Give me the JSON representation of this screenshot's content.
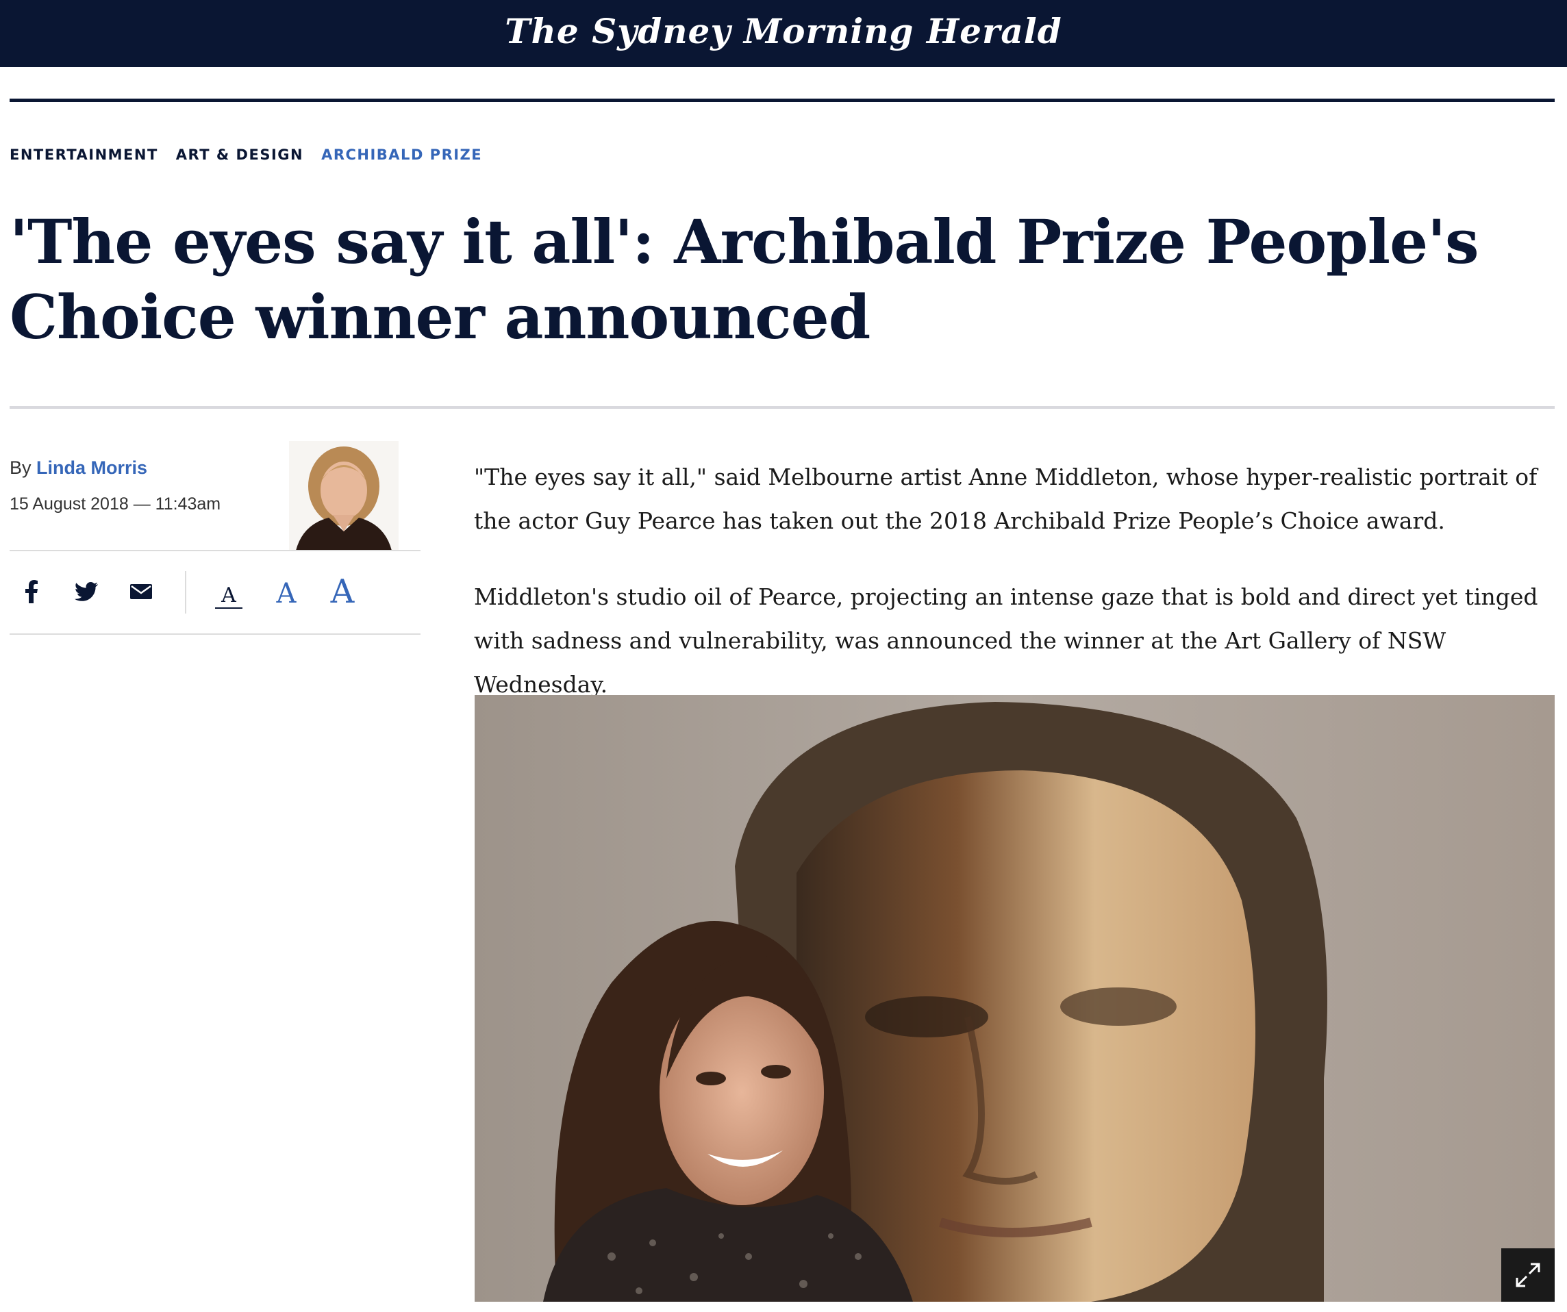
{
  "masthead": {
    "title": "The Sydney Morning Herald",
    "background": "#0a1633"
  },
  "breadcrumbs": [
    {
      "label": "ENTERTAINMENT"
    },
    {
      "label": "ART & DESIGN"
    },
    {
      "label": "ARCHIBALD PRIZE",
      "active": true
    }
  ],
  "article": {
    "headline": "'The eyes say it all': Archibald Prize People's Choice winner announced",
    "byline_prefix": "By",
    "author": "Linda Morris",
    "date": "15 August 2018 — 11:43am",
    "paragraphs": [
      "\"The eyes say it all,\" said Melbourne artist Anne Middleton, whose hyper-realistic portrait of the actor Guy Pearce has taken out the 2018 Archibald Prize People’s Choice award.",
      "Middleton's studio oil of Pearce, projecting an intense gaze that is bold and direct yet tinged with sadness and vulnerability, was announced the winner at the Art Gallery of NSW Wednesday."
    ]
  },
  "share": {
    "icons": [
      "facebook-icon",
      "twitter-icon",
      "email-icon"
    ]
  },
  "text_size": {
    "small": "A",
    "medium": "A",
    "large": "A"
  },
  "colors": {
    "link": "#3566b8",
    "navy": "#0a1633"
  },
  "photo": {
    "icon": "expand-icon"
  }
}
